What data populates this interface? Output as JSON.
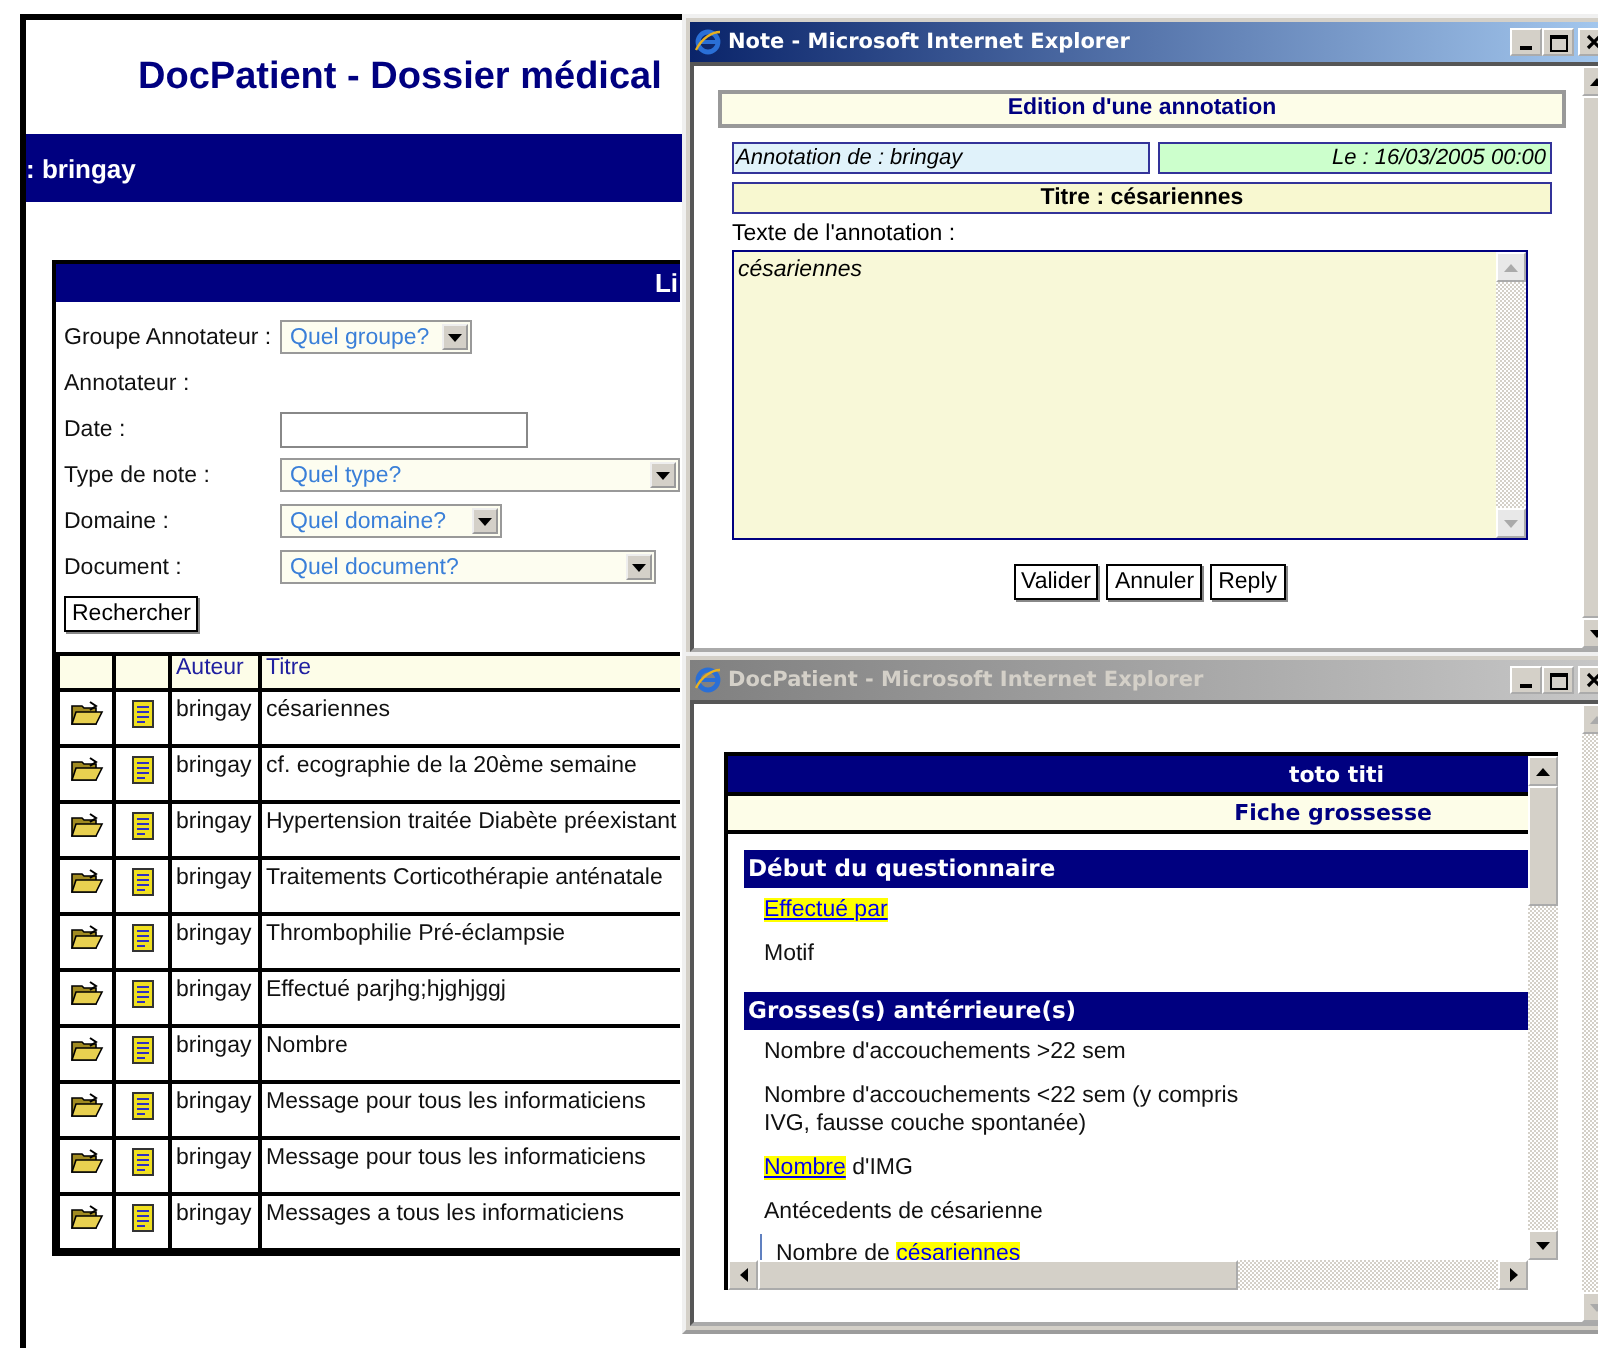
{
  "main_page": {
    "title": "DocPatient - Dossier médical",
    "user_bar": ": bringay",
    "search_panel": {
      "header": "Li",
      "fields": [
        {
          "kind": "select",
          "label": "Groupe Annotateur :",
          "value": "Quel groupe?"
        },
        {
          "kind": "label",
          "label": "Annotateur :"
        },
        {
          "kind": "input",
          "label": "Date :"
        },
        {
          "kind": "select",
          "label": "Type de note :",
          "value": "Quel type?"
        },
        {
          "kind": "select",
          "label": "Domaine :",
          "value": "Quel domaine?"
        },
        {
          "kind": "select",
          "label": "Document :",
          "value": "Quel document?"
        }
      ],
      "search_button": "Rechercher"
    },
    "table": {
      "columns": [
        "Auteur",
        "Titre"
      ],
      "rows": [
        {
          "author": "bringay",
          "title": "césariennes"
        },
        {
          "author": "bringay",
          "title": "cf. ecographie de la 20ème semaine"
        },
        {
          "author": "bringay",
          "title": "Hypertension traitée Diabète préexistant"
        },
        {
          "author": "bringay",
          "title": "Traitements Corticothérapie anténatale"
        },
        {
          "author": "bringay",
          "title": "Thrombophilie Pré-éclampsie"
        },
        {
          "author": "bringay",
          "title": "Effectué parjhg;hjghjggj"
        },
        {
          "author": "bringay",
          "title": "Nombre"
        },
        {
          "author": "bringay",
          "title": "Message pour tous les informaticiens"
        },
        {
          "author": "bringay",
          "title": "Message pour tous les informaticiens"
        },
        {
          "author": "bringay",
          "title": "Messages a tous les informaticiens"
        }
      ]
    }
  },
  "note_window": {
    "title": "Note - Microsoft Internet Explorer",
    "active": true,
    "heading": "Edition d'une annotation",
    "author": "Annotation de : bringay",
    "date": "Le : 16/03/2005 00:00",
    "subject": "Titre : césariennes",
    "text_label": "Texte de l'annotation :",
    "text": "césariennes",
    "buttons": [
      "Valider",
      "Annuler",
      "Reply"
    ]
  },
  "form_window": {
    "title": "DocPatient - Microsoft Internet Explorer",
    "active": false,
    "patient": "toto titi",
    "form_title": "Fiche grossesse",
    "sections": [
      {
        "title": "Début du questionnaire",
        "items": [
          {
            "kind": "linked",
            "link": "Effectué par"
          },
          {
            "kind": "plain",
            "text": "Motif"
          }
        ]
      },
      {
        "title": "Grosses(s) antérrieure(s)",
        "items": [
          {
            "kind": "plain",
            "text": "Nombre d'accouchements >22 sem"
          },
          {
            "kind": "plain",
            "text": "Nombre d'accouchements <22 sem (y compris IVG, fausse couche spontanée)"
          },
          {
            "kind": "linked",
            "link": "Nombre",
            "after": " d'IMG"
          },
          {
            "kind": "plain",
            "text": "Antécedents de césarienne",
            "children": [
              {
                "kind": "linked",
                "before": "Nombre de ",
                "link": "césariennes"
              }
            ]
          }
        ]
      }
    ]
  }
}
